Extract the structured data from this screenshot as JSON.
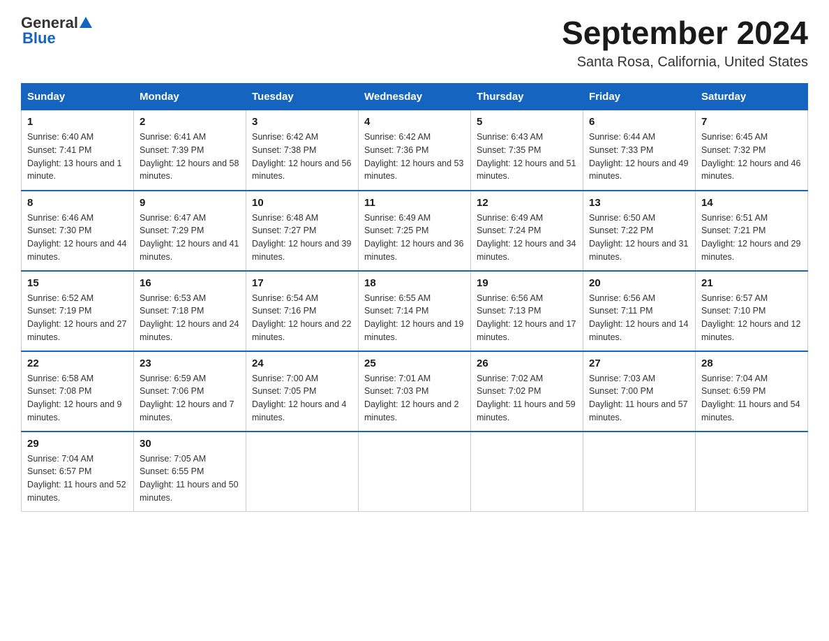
{
  "logo": {
    "general": "General",
    "triangle": "▲",
    "blue": "Blue"
  },
  "header": {
    "title": "September 2024",
    "subtitle": "Santa Rosa, California, United States"
  },
  "days_of_week": [
    "Sunday",
    "Monday",
    "Tuesday",
    "Wednesday",
    "Thursday",
    "Friday",
    "Saturday"
  ],
  "weeks": [
    [
      {
        "day": "1",
        "sunrise": "6:40 AM",
        "sunset": "7:41 PM",
        "daylight": "13 hours and 1 minute."
      },
      {
        "day": "2",
        "sunrise": "6:41 AM",
        "sunset": "7:39 PM",
        "daylight": "12 hours and 58 minutes."
      },
      {
        "day": "3",
        "sunrise": "6:42 AM",
        "sunset": "7:38 PM",
        "daylight": "12 hours and 56 minutes."
      },
      {
        "day": "4",
        "sunrise": "6:42 AM",
        "sunset": "7:36 PM",
        "daylight": "12 hours and 53 minutes."
      },
      {
        "day": "5",
        "sunrise": "6:43 AM",
        "sunset": "7:35 PM",
        "daylight": "12 hours and 51 minutes."
      },
      {
        "day": "6",
        "sunrise": "6:44 AM",
        "sunset": "7:33 PM",
        "daylight": "12 hours and 49 minutes."
      },
      {
        "day": "7",
        "sunrise": "6:45 AM",
        "sunset": "7:32 PM",
        "daylight": "12 hours and 46 minutes."
      }
    ],
    [
      {
        "day": "8",
        "sunrise": "6:46 AM",
        "sunset": "7:30 PM",
        "daylight": "12 hours and 44 minutes."
      },
      {
        "day": "9",
        "sunrise": "6:47 AM",
        "sunset": "7:29 PM",
        "daylight": "12 hours and 41 minutes."
      },
      {
        "day": "10",
        "sunrise": "6:48 AM",
        "sunset": "7:27 PM",
        "daylight": "12 hours and 39 minutes."
      },
      {
        "day": "11",
        "sunrise": "6:49 AM",
        "sunset": "7:25 PM",
        "daylight": "12 hours and 36 minutes."
      },
      {
        "day": "12",
        "sunrise": "6:49 AM",
        "sunset": "7:24 PM",
        "daylight": "12 hours and 34 minutes."
      },
      {
        "day": "13",
        "sunrise": "6:50 AM",
        "sunset": "7:22 PM",
        "daylight": "12 hours and 31 minutes."
      },
      {
        "day": "14",
        "sunrise": "6:51 AM",
        "sunset": "7:21 PM",
        "daylight": "12 hours and 29 minutes."
      }
    ],
    [
      {
        "day": "15",
        "sunrise": "6:52 AM",
        "sunset": "7:19 PM",
        "daylight": "12 hours and 27 minutes."
      },
      {
        "day": "16",
        "sunrise": "6:53 AM",
        "sunset": "7:18 PM",
        "daylight": "12 hours and 24 minutes."
      },
      {
        "day": "17",
        "sunrise": "6:54 AM",
        "sunset": "7:16 PM",
        "daylight": "12 hours and 22 minutes."
      },
      {
        "day": "18",
        "sunrise": "6:55 AM",
        "sunset": "7:14 PM",
        "daylight": "12 hours and 19 minutes."
      },
      {
        "day": "19",
        "sunrise": "6:56 AM",
        "sunset": "7:13 PM",
        "daylight": "12 hours and 17 minutes."
      },
      {
        "day": "20",
        "sunrise": "6:56 AM",
        "sunset": "7:11 PM",
        "daylight": "12 hours and 14 minutes."
      },
      {
        "day": "21",
        "sunrise": "6:57 AM",
        "sunset": "7:10 PM",
        "daylight": "12 hours and 12 minutes."
      }
    ],
    [
      {
        "day": "22",
        "sunrise": "6:58 AM",
        "sunset": "7:08 PM",
        "daylight": "12 hours and 9 minutes."
      },
      {
        "day": "23",
        "sunrise": "6:59 AM",
        "sunset": "7:06 PM",
        "daylight": "12 hours and 7 minutes."
      },
      {
        "day": "24",
        "sunrise": "7:00 AM",
        "sunset": "7:05 PM",
        "daylight": "12 hours and 4 minutes."
      },
      {
        "day": "25",
        "sunrise": "7:01 AM",
        "sunset": "7:03 PM",
        "daylight": "12 hours and 2 minutes."
      },
      {
        "day": "26",
        "sunrise": "7:02 AM",
        "sunset": "7:02 PM",
        "daylight": "11 hours and 59 minutes."
      },
      {
        "day": "27",
        "sunrise": "7:03 AM",
        "sunset": "7:00 PM",
        "daylight": "11 hours and 57 minutes."
      },
      {
        "day": "28",
        "sunrise": "7:04 AM",
        "sunset": "6:59 PM",
        "daylight": "11 hours and 54 minutes."
      }
    ],
    [
      {
        "day": "29",
        "sunrise": "7:04 AM",
        "sunset": "6:57 PM",
        "daylight": "11 hours and 52 minutes."
      },
      {
        "day": "30",
        "sunrise": "7:05 AM",
        "sunset": "6:55 PM",
        "daylight": "11 hours and 50 minutes."
      },
      null,
      null,
      null,
      null,
      null
    ]
  ]
}
